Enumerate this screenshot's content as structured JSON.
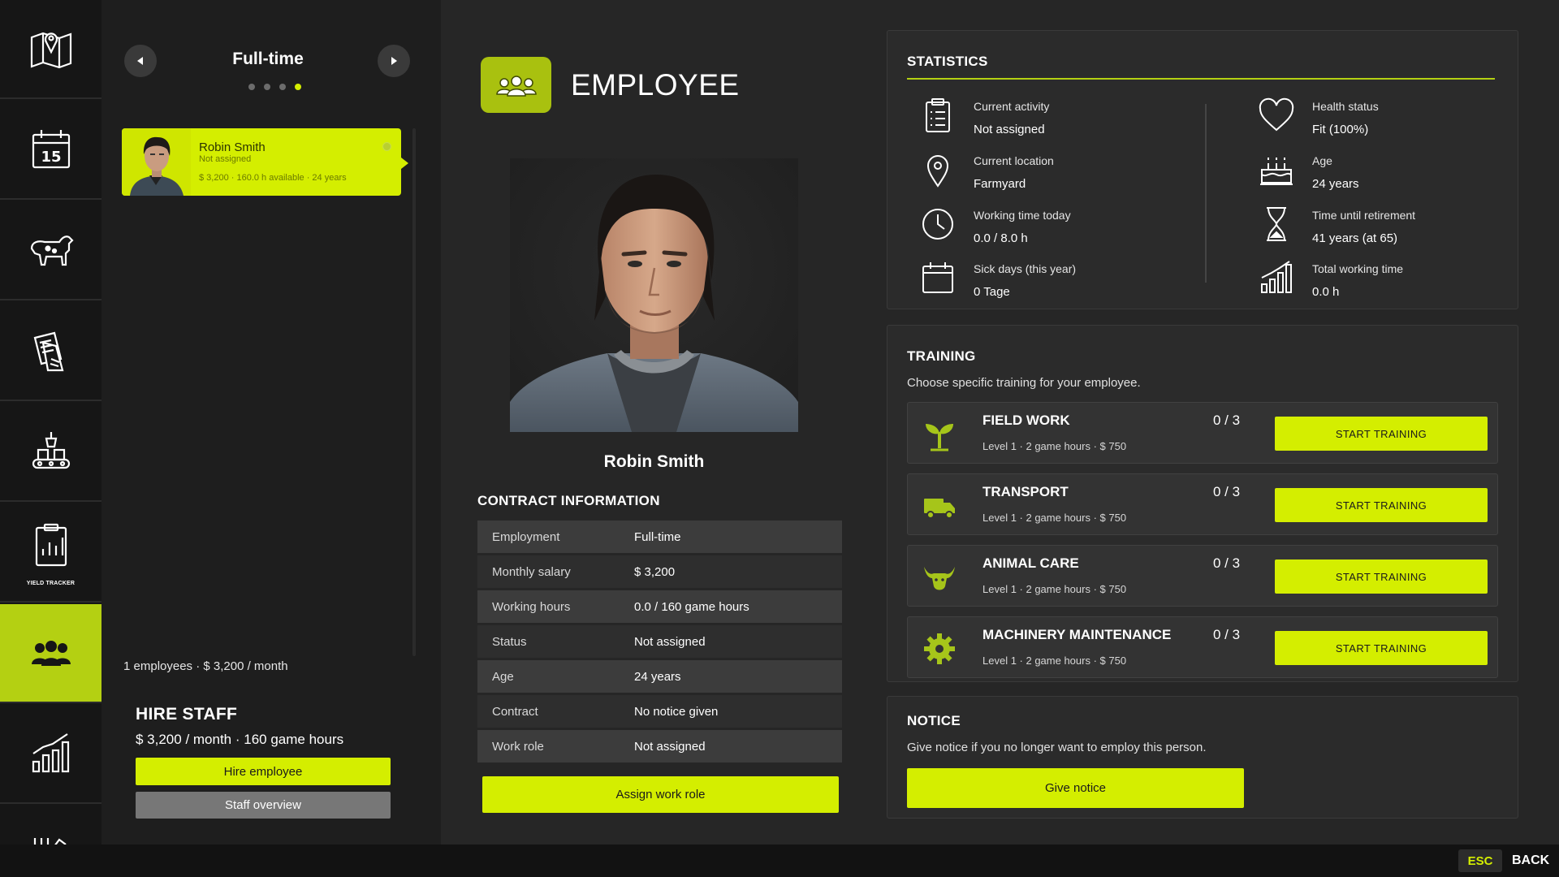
{
  "nav": {
    "items": [
      {
        "icon": "map-icon",
        "caption": ""
      },
      {
        "icon": "calendar-icon",
        "caption": "",
        "calendar_day": "15"
      },
      {
        "icon": "livestock-icon",
        "caption": ""
      },
      {
        "icon": "contracts-icon",
        "caption": ""
      },
      {
        "icon": "production-icon",
        "caption": ""
      },
      {
        "icon": "yield-tracker-icon",
        "caption": "YIELD TRACKER"
      },
      {
        "icon": "staff-icon",
        "caption": "",
        "active": true
      },
      {
        "icon": "statistics-icon",
        "caption": ""
      }
    ]
  },
  "list": {
    "category": "Full-time",
    "pages": 4,
    "current_page": 4,
    "employees": [
      {
        "name": "Robin Smith",
        "status": "Not assigned",
        "meta": "$ 3,200  ·  160.0 h available  ·  24 years"
      }
    ],
    "summary": "1 employees  ·  $ 3,200 / month"
  },
  "hire": {
    "title": "HIRE STAFF",
    "terms": "$ 3,200 / month  ·  160 game hours",
    "hire_button": "Hire employee",
    "overview_button": "Staff overview"
  },
  "employee": {
    "heading": "EMPLOYEE",
    "name": "Robin Smith",
    "contract_title": "CONTRACT INFORMATION",
    "contract": [
      {
        "key": "Employment",
        "value": "Full-time"
      },
      {
        "key": "Monthly salary",
        "value": "$ 3,200"
      },
      {
        "key": "Working hours",
        "value": "0.0 / 160 game hours"
      },
      {
        "key": "Status",
        "value": "Not assigned"
      },
      {
        "key": "Age",
        "value": "24 years"
      },
      {
        "key": "Contract",
        "value": "No notice given"
      },
      {
        "key": "Work role",
        "value": "Not assigned"
      }
    ],
    "assign_button": "Assign work role"
  },
  "statistics": {
    "title": "STATISTICS",
    "left": [
      {
        "icon": "clipboard-icon",
        "label": "Current activity",
        "value": "Not assigned"
      },
      {
        "icon": "location-pin-icon",
        "label": "Current location",
        "value": "Farmyard"
      },
      {
        "icon": "clock-icon",
        "label": "Working time today",
        "value": "0.0 / 8.0 h"
      },
      {
        "icon": "calendar-icon",
        "label": "Sick days (this year)",
        "value": "0 Tage"
      }
    ],
    "right": [
      {
        "icon": "heart-icon",
        "label": "Health status",
        "value": "Fit (100%)"
      },
      {
        "icon": "cake-icon",
        "label": "Age",
        "value": "24 years"
      },
      {
        "icon": "hourglass-icon",
        "label": "Time until retirement",
        "value": "41 years (at 65)"
      },
      {
        "icon": "bar-chart-icon",
        "label": "Total working time",
        "value": "0.0 h"
      }
    ]
  },
  "training": {
    "title": "TRAINING",
    "subtitle": "Choose specific training for your employee.",
    "button_label": "START TRAINING",
    "items": [
      {
        "icon": "sprout-icon",
        "name": "FIELD WORK",
        "desc": "Level 1 · 2 game hours · $ 750",
        "progress": "0 / 3"
      },
      {
        "icon": "truck-icon",
        "name": "TRANSPORT",
        "desc": "Level 1 · 2 game hours · $ 750",
        "progress": "0 / 3"
      },
      {
        "icon": "cow-head-icon",
        "name": "ANIMAL CARE",
        "desc": "Level 1 · 2 game hours · $ 750",
        "progress": "0 / 3"
      },
      {
        "icon": "gear-icon",
        "name": "MACHINERY MAINTENANCE",
        "desc": "Level 1 · 2 game hours · $ 750",
        "progress": "0 / 3"
      }
    ]
  },
  "notice": {
    "title": "NOTICE",
    "subtitle": "Give notice if you no longer want to employ this person.",
    "button": "Give notice"
  },
  "footer": {
    "esc": "ESC",
    "back": "BACK"
  },
  "colors": {
    "accent": "#d4ee00",
    "nav_active": "#b4d012",
    "panel": "#2b2b2b",
    "background": "#262626"
  }
}
